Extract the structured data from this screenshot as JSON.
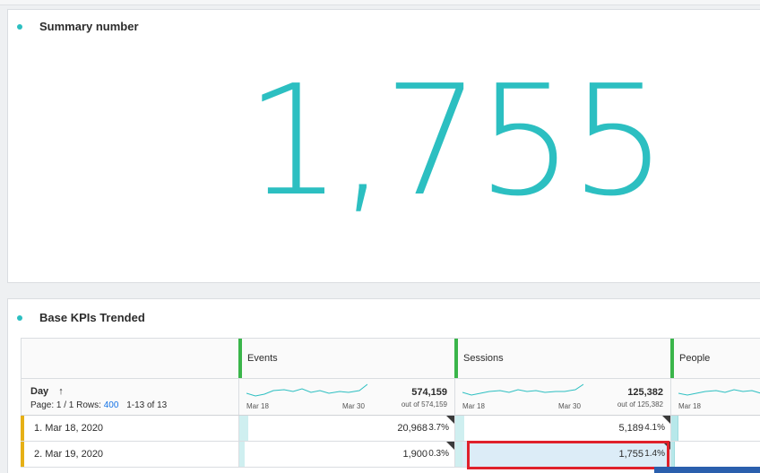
{
  "summary_panel": {
    "title": "Summary number",
    "value": "1,755"
  },
  "kpi_panel": {
    "title": "Base KPIs Trended",
    "day_header": "Day",
    "sort_arrow": "↑",
    "page_label": "Page: 1 / 1 Rows:",
    "rows_value": "400",
    "range_text": "1-13 of 13",
    "metrics": [
      {
        "name": "Events",
        "total": "574,159",
        "total_sub": "out of 574,159",
        "x_start": "Mar 18",
        "x_end": "Mar 30"
      },
      {
        "name": "Sessions",
        "total": "125,382",
        "total_sub": "out of 125,382",
        "x_start": "Mar 18",
        "x_end": "Mar 30"
      },
      {
        "name": "People",
        "x_start": "Mar 18"
      }
    ],
    "rows": [
      {
        "label": "1. Mar 18, 2020",
        "events": "20,968",
        "events_pct": "3.7%",
        "sessions": "5,189",
        "sessions_pct": "4.1%"
      },
      {
        "label": "2. Mar 19, 2020",
        "events": "1,900",
        "events_pct": "0.3%",
        "sessions": "1,755",
        "sessions_pct": "1.4%"
      }
    ]
  },
  "colors": {
    "accent": "#2cbfc1",
    "metric_bar": "#3ab54a",
    "row_accent": "#e6b016",
    "highlight": "#e0212b",
    "link": "#1473e6"
  }
}
